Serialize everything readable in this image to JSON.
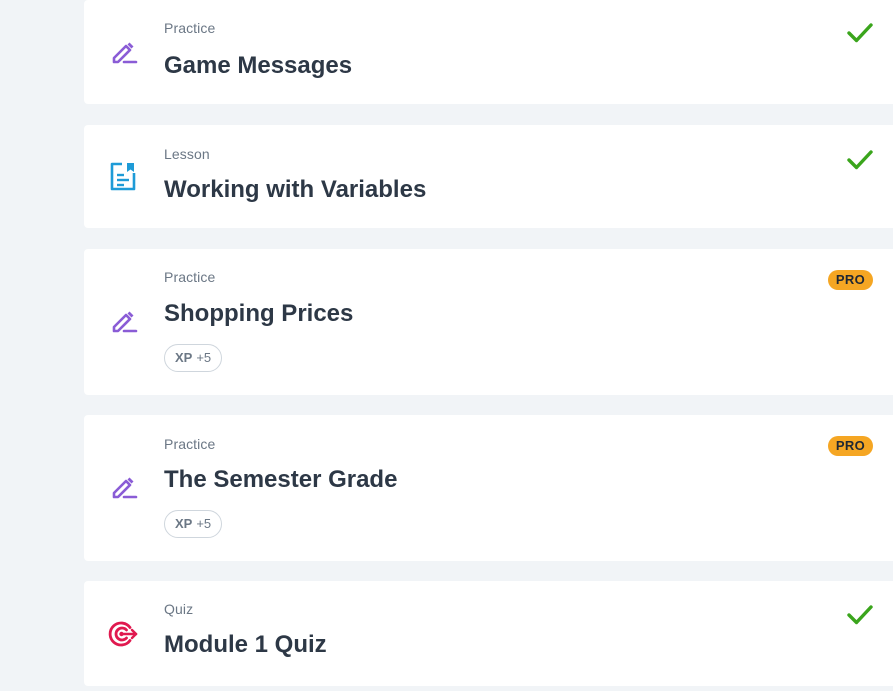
{
  "colors": {
    "background": "#f1f4f7",
    "card": "#ffffff",
    "practice_icon": "#8a5cd6",
    "lesson_icon": "#1e9bd7",
    "quiz_icon": "#e0194f",
    "check": "#3aa51c",
    "pro_badge": "#f5a623"
  },
  "items": [
    {
      "type": "Practice",
      "title": "Game Messages",
      "icon": "pencil-icon",
      "status": "completed",
      "status_icon": "checkmark-icon"
    },
    {
      "type": "Lesson",
      "title": "Working with Variables",
      "icon": "lesson-document-icon",
      "status": "completed",
      "status_icon": "checkmark-icon"
    },
    {
      "type": "Practice",
      "title": "Shopping Prices",
      "icon": "pencil-icon",
      "badge": "PRO",
      "xp_label": "XP",
      "xp_value": "+5"
    },
    {
      "type": "Practice",
      "title": "The Semester Grade",
      "icon": "pencil-icon",
      "badge": "PRO",
      "xp_label": "XP",
      "xp_value": "+5"
    },
    {
      "type": "Quiz",
      "title": "Module 1 Quiz",
      "icon": "quiz-target-icon",
      "status": "completed",
      "status_icon": "checkmark-icon"
    }
  ]
}
